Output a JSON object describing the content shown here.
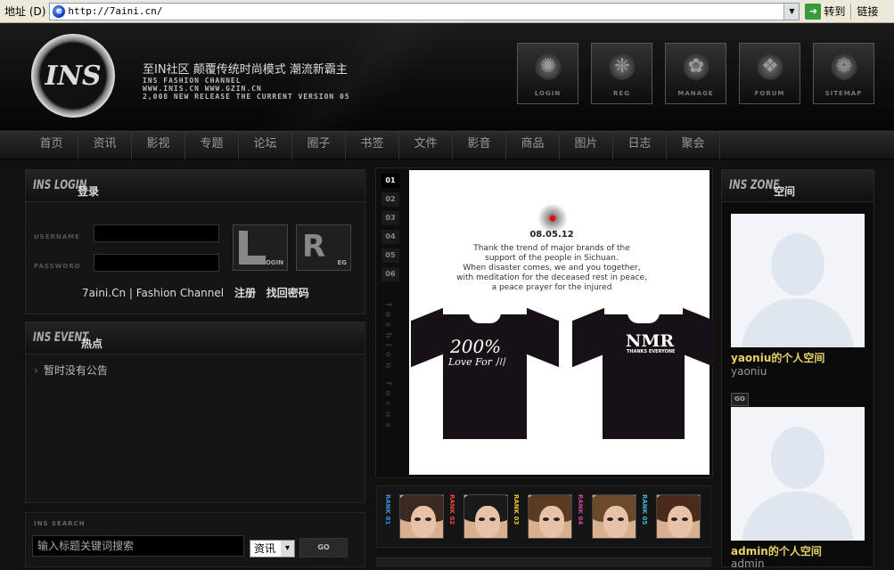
{
  "address_bar": {
    "label": "地址 (D)",
    "url": "http://7aini.cn/",
    "go_label": "转到",
    "links_label": "链接"
  },
  "header": {
    "logo_text": "INS",
    "slogan": "至IN社区  颠覆传统时尚模式  潮流新霸主",
    "sub_lines": [
      "INS FASHION CHANNEL",
      "WWW.INIS.CN WWW.GZIN.CN",
      "2,008 NEW RELEASE  THE CURRENT VERSION 05"
    ],
    "top_buttons": [
      {
        "name": "login",
        "label": "LOGIN",
        "glyph": "✺"
      },
      {
        "name": "reg",
        "label": "REG",
        "glyph": "❈"
      },
      {
        "name": "manage",
        "label": "MANAGE",
        "glyph": "✿"
      },
      {
        "name": "forum",
        "label": "FORUM",
        "glyph": "❖"
      },
      {
        "name": "sitemap",
        "label": "SITEMAP",
        "glyph": "❁"
      }
    ]
  },
  "nav": [
    "首页",
    "资讯",
    "影视",
    "专题",
    "论坛",
    "圈子",
    "书签",
    "文件",
    "影音",
    "商品",
    "图片",
    "日志",
    "聚会"
  ],
  "login_panel": {
    "title_en": "INS LOGIN",
    "title_cn": "登录",
    "username_label": "USERNAME",
    "password_label": "PASSWORD",
    "login_btn": "OGIN",
    "reg_btn": "EG",
    "site_link": "7aini.Cn | Fashion Channel",
    "register_link": "注册",
    "recover_link": "找回密码"
  },
  "event_panel": {
    "title_en": "INS EVENT",
    "title_cn": "热点",
    "items": [
      "暂时没有公告"
    ]
  },
  "search_panel": {
    "title": "INS SEARCH",
    "placeholder": "输入标题关键词搜索",
    "category": "资讯",
    "go": "GO"
  },
  "feature": {
    "tabs": [
      "01",
      "02",
      "03",
      "04",
      "05",
      "06"
    ],
    "vertical_label": "fashion focus",
    "date": "08.05.12",
    "text_lines": [
      "Thank the trend of major brands of the",
      "support of the people in Sichuan.",
      "When disaster comes, we and you together,",
      "with meditation for the deceased rest in peace,",
      "a peace prayer for the injured"
    ],
    "shirt1_title": "200%",
    "shirt1_sub": "Love For 川",
    "shirt2_title": "NMR",
    "shirt2_sub": "THANKS EVERYONE"
  },
  "rank": [
    {
      "label": "RANK 01",
      "color": "#3a8fd8",
      "hair": "#3b2a20"
    },
    {
      "label": "RANK 02",
      "color": "#e0483a",
      "hair": "#1a1a1a"
    },
    {
      "label": "RANK 03",
      "color": "#e8c030",
      "hair": "#5a3a20"
    },
    {
      "label": "RANK 04",
      "color": "#d040a0",
      "hair": "#6a4a2a"
    },
    {
      "label": "RANK 05",
      "color": "#40b0d0",
      "hair": "#4a2a1a"
    }
  ],
  "zone": {
    "title_en": "INS ZONE",
    "title_cn": "空间",
    "items": [
      {
        "title": "yaoniu的个人空间",
        "user": "yaoniu",
        "go": "GO"
      },
      {
        "title": "admin的个人空间",
        "user": "admin"
      }
    ]
  }
}
